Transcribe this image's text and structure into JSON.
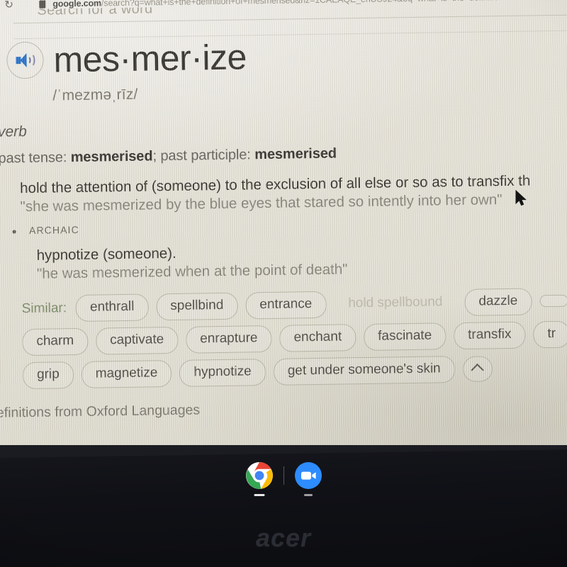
{
  "browser": {
    "reload_icon": "reload-icon",
    "lock_icon": "lock-icon",
    "url_host": "google.com",
    "url_path": "/search?q=what+is+the+definition+of+mesmerised&rlz=1CAEAQE_enUS924&oq=what+is+the+definition+of+mesm"
  },
  "ghost": {
    "clipped_search_label": "Search for a word"
  },
  "dictionary": {
    "speaker_icon": "speaker-icon",
    "headword": "mes·mer·ize",
    "phonetic": "/ˈmezməˌrīz/",
    "part_of_speech": "verb",
    "tenses_prefix": "past tense: ",
    "tenses_past": "mesmerised",
    "tenses_mid": "; past participle: ",
    "tenses_participle": "mesmerised",
    "sense_1": {
      "definition": "hold the attention of (someone) to the exclusion of all else or so as to transfix th",
      "example": "\"she was mesmerized by the blue eyes that stared so intently into her own\""
    },
    "sense_2": {
      "bullet": "•",
      "label": "ARCHAIC",
      "definition": "hypnotize (someone).",
      "example": "\"he was mesmerized when at the point of death\""
    },
    "similar_label": "Similar:",
    "similar_rows": [
      [
        {
          "text": "enthrall",
          "style": "chip"
        },
        {
          "text": "spellbind",
          "style": "chip"
        },
        {
          "text": "entrance",
          "style": "chip"
        },
        {
          "text": "hold spellbound",
          "style": "faded"
        },
        {
          "text": "dazzle",
          "style": "chip"
        },
        {
          "text": "",
          "style": "chip"
        }
      ],
      [
        {
          "text": "charm",
          "style": "chip"
        },
        {
          "text": "captivate",
          "style": "chip"
        },
        {
          "text": "enrapture",
          "style": "chip"
        },
        {
          "text": "enchant",
          "style": "chip"
        },
        {
          "text": "fascinate",
          "style": "chip"
        },
        {
          "text": "transfix",
          "style": "chip"
        },
        {
          "text": "tr",
          "style": "chip"
        }
      ],
      [
        {
          "text": "grip",
          "style": "chip"
        },
        {
          "text": "magnetize",
          "style": "chip"
        },
        {
          "text": "hypnotize",
          "style": "chip"
        },
        {
          "text": "get under someone's skin",
          "style": "chip"
        }
      ]
    ],
    "collapse_icon": "chevron-up-icon",
    "attribution": "efinitions from Oxford Languages"
  },
  "cursor": {
    "icon": "mouse-pointer-icon"
  },
  "shelf": {
    "chrome_icon": "chrome-icon",
    "zoom_icon": "zoom-app-icon"
  },
  "device": {
    "brand": "acer"
  },
  "colors": {
    "screen_bg": "#e6e3d8",
    "text": "#24221e",
    "muted_text": "#7d7a70",
    "similar_label": "#70805a",
    "speaker_blue": "#1566c8",
    "bezel": "#101116"
  }
}
